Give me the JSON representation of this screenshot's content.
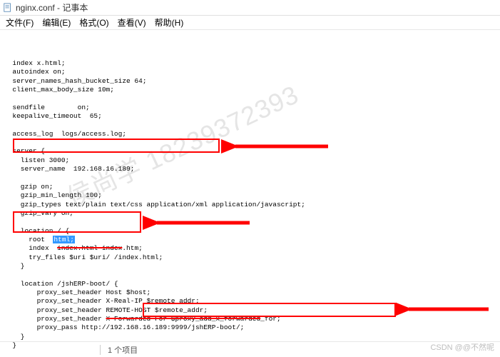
{
  "title": "nginx.conf - 记事本",
  "menu": [
    "文件(F)",
    "编辑(E)",
    "格式(O)",
    "查看(V)",
    "帮助(H)"
  ],
  "code": {
    "l1": "  index x.html;",
    "l2": "  autoindex on;",
    "l3": "  server_names_hash_bucket_size 64;",
    "l4": "  client_max_body_size 10m;",
    "l5": "",
    "l6": "  sendfile        on;",
    "l7": "  keepalive_timeout  65;",
    "l8": "",
    "l9": "  access_log  logs/access.log;",
    "l10": "",
    "l11": "  server {",
    "l12": "    listen 3000;",
    "l13_pre": "    server_name  ",
    "l13_val": "192.168.16.189;",
    "l14": "",
    "l15": "    gzip on;",
    "l16": "    gzip_min_length 100;",
    "l17": "    gzip_types text/plain text/css application/xml application/javascript;",
    "l18": "    gzip_vary on;",
    "l19": "",
    "l20": "    location / {",
    "l21_pre": "      root  ",
    "l21_sel": "html;",
    "l22_pre": "      index  ",
    "l22_strike": "index.html index",
    "l22_post": ".htm;",
    "l23": "      try_files $uri $uri/ /index.html;",
    "l24": "    }",
    "l25": "",
    "l26": "    location /jshERP-boot/ {",
    "l27": "        proxy_set_header Host $host;",
    "l28": "        proxy_set_header X-Real-IP $remote_addr;",
    "l29": "        proxy_set_header REMOTE-HOST $remote_addr;",
    "l30_pre": "        proxy_set_header ",
    "l30_strike": "X-Forwarded-For $proxy_add_x_forwarded",
    "l30_post": "_for;",
    "l31_pre": "        proxy_pass http://",
    "l31_box": "192.168.16.189:9999/jshERP-boot/;",
    "l32": "    }",
    "l33": "  }",
    "l34": "}"
  },
  "status": "1 个项目",
  "watermark": "侯尚学 18239372393",
  "credit": "CSDN @@不然呢"
}
